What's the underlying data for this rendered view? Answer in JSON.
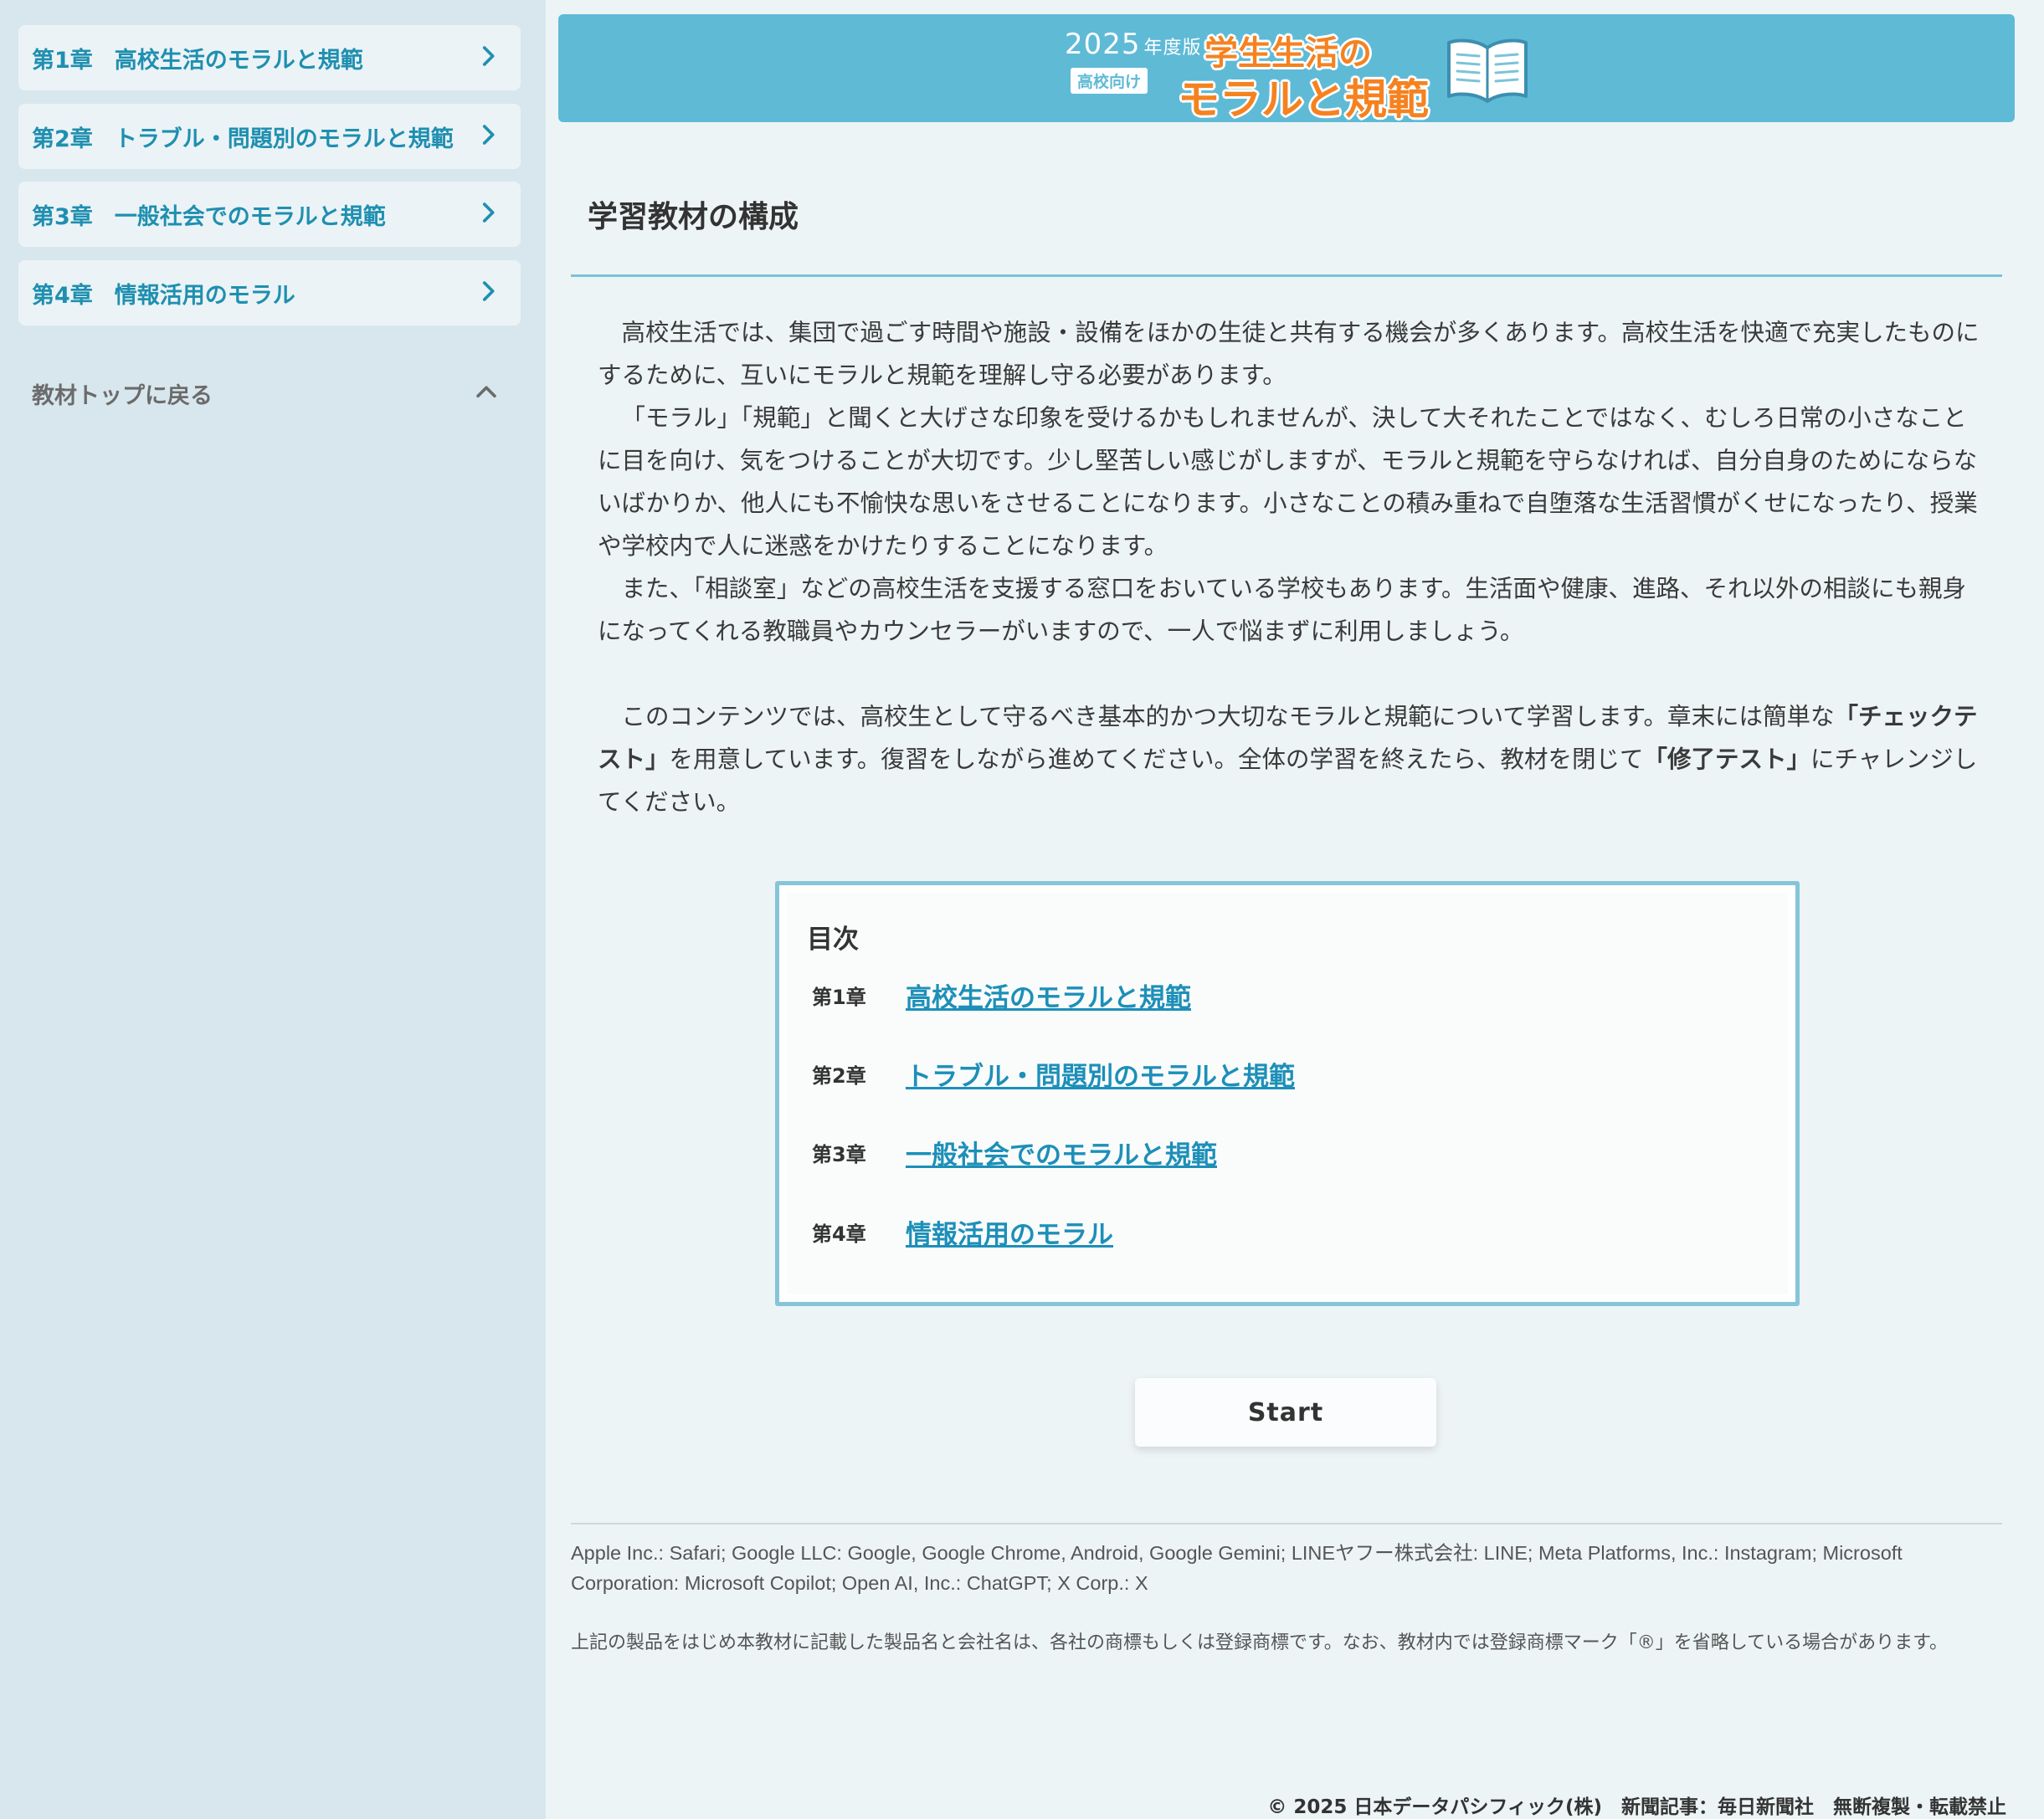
{
  "sidebar": {
    "chapters": [
      {
        "num": "第1章",
        "title": "高校生活のモラルと規範"
      },
      {
        "num": "第2章",
        "title": "トラブル・問題別のモラルと規範"
      },
      {
        "num": "第3章",
        "title": "一般社会でのモラルと規範"
      },
      {
        "num": "第4章",
        "title": "情報活用のモラル"
      }
    ],
    "back_label": "教材トップに戻る"
  },
  "banner": {
    "year": "2025",
    "edition": "年度版",
    "badge": "高校向け",
    "title_line1": "学生生活の",
    "title_line2": "モラルと規範"
  },
  "main": {
    "section_title": "学習教材の構成",
    "paragraphs": {
      "p1": "高校生活では、集団で過ごす時間や施設・設備をほかの生徒と共有する機会が多くあります。高校生活を快適で充実したものにするために、互いにモラルと規範を理解し守る必要があります。",
      "p2": "「モラル」「規範」と聞くと大げさな印象を受けるかもしれませんが、決して大それたことではなく、むしろ日常の小さなことに目を向け、気をつけることが大切です。少し堅苦しい感じがしますが、モラルと規範を守らなければ、自分自身のためにならないばかりか、他人にも不愉快な思いをさせることになります。小さなことの積み重ねで自堕落な生活習慣がくせになったり、授業や学校内で人に迷惑をかけたりすることになります。",
      "p3": "また、「相談室」などの高校生活を支援する窓口をおいている学校もあります。生活面や健康、進路、それ以外の相談にも親身になってくれる教職員やカウンセラーがいますので、一人で悩まずに利用しましょう。",
      "p4_a": "このコンテンツでは、高校生として守るべき基本的かつ大切なモラルと規範について学習します。章末には簡単な",
      "p4_b": "「チェックテスト」",
      "p4_c": "を用意しています。復習をしながら進めてください。全体の学習を終えたら、教材を閉じて",
      "p4_d": "「修了テスト」",
      "p4_e": "にチャレンジしてください。"
    }
  },
  "toc": {
    "title": "目次",
    "items": [
      {
        "num": "第1章",
        "title": "高校生活のモラルと規範"
      },
      {
        "num": "第2章",
        "title": "トラブル・問題別のモラルと規範"
      },
      {
        "num": "第3章",
        "title": "一般社会でのモラルと規範"
      },
      {
        "num": "第4章",
        "title": "情報活用のモラル"
      }
    ]
  },
  "start_label": "Start",
  "footer": {
    "trademarks": "Apple Inc.: Safari; Google LLC: Google, Google Chrome, Android, Google Gemini; LINEヤフー株式会社: LINE; Meta Platforms, Inc.: Instagram; Microsoft Corporation: Microsoft Copilot; Open AI, Inc.: ChatGPT; X Corp.: X",
    "note": "上記の製品をはじめ本教材に記載した製品名と会社名は、各社の商標もしくは登録商標です。なお、教材内では登録商標マーク「®」を省略している場合があります。",
    "copyright": "© 2025 日本データパシフィック(株)　新聞記事：毎日新聞社　無断複製・転載禁止"
  },
  "colors": {
    "accent": "#1f8fb0",
    "banner": "#5fbad6",
    "banner_title": "#f58220",
    "toc_border": "#86c5d9",
    "sidebar_bg": "#d8e7ed",
    "page_bg": "#edf4f6"
  },
  "icons": {
    "chapter_nav": "chevron-right-icon",
    "back": "chevron-up-icon",
    "banner": "book-icon"
  }
}
